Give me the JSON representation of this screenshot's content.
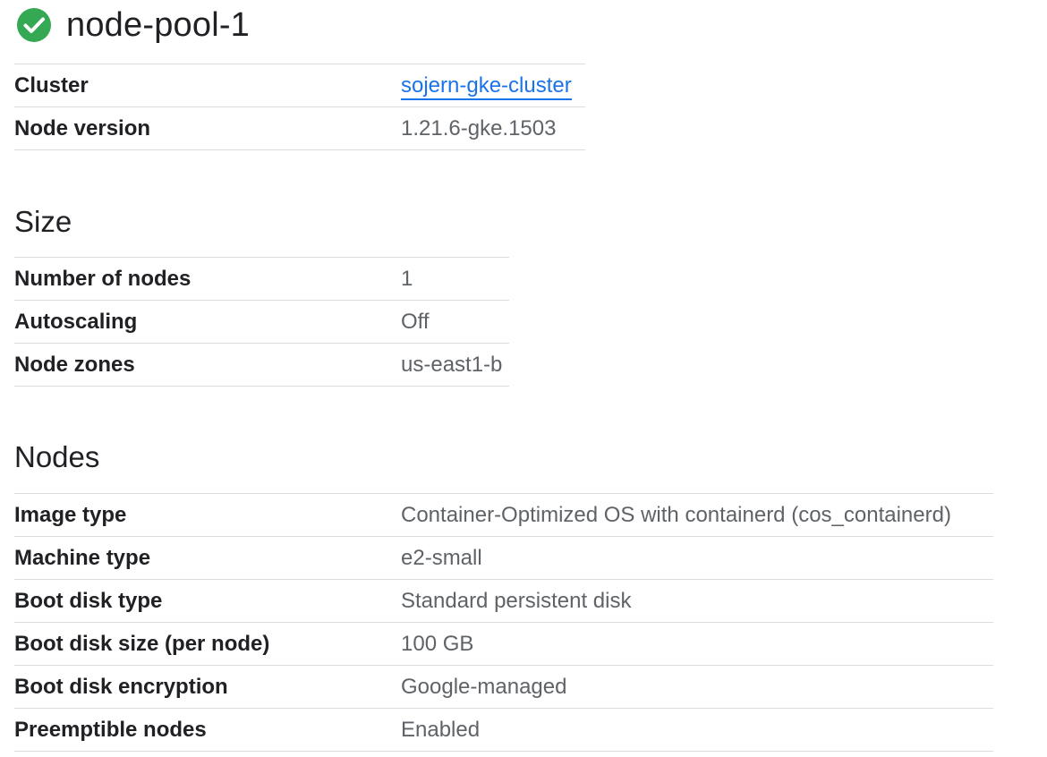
{
  "header": {
    "title": "node-pool-1",
    "status_icon": "check-circle-icon",
    "status_color": "#34a853"
  },
  "general": {
    "rows": [
      {
        "label": "Cluster",
        "value": "sojern-gke-cluster",
        "is_link": true
      },
      {
        "label": "Node version",
        "value": "1.21.6-gke.1503"
      }
    ]
  },
  "size": {
    "heading": "Size",
    "rows": [
      {
        "label": "Number of nodes",
        "value": "1"
      },
      {
        "label": "Autoscaling",
        "value": "Off"
      },
      {
        "label": "Node zones",
        "value": "us-east1-b"
      }
    ]
  },
  "nodes": {
    "heading": "Nodes",
    "rows": [
      {
        "label": "Image type",
        "value": "Container-Optimized OS with containerd (cos_containerd)"
      },
      {
        "label": "Machine type",
        "value": "e2-small"
      },
      {
        "label": "Boot disk type",
        "value": "Standard persistent disk"
      },
      {
        "label": "Boot disk size (per node)",
        "value": "100 GB"
      },
      {
        "label": "Boot disk encryption",
        "value": "Google-managed"
      },
      {
        "label": "Preemptible nodes",
        "value": "Enabled"
      }
    ]
  },
  "colors": {
    "link": "#1a73e8",
    "divider": "#dadce0",
    "value_text": "#5f6368"
  }
}
